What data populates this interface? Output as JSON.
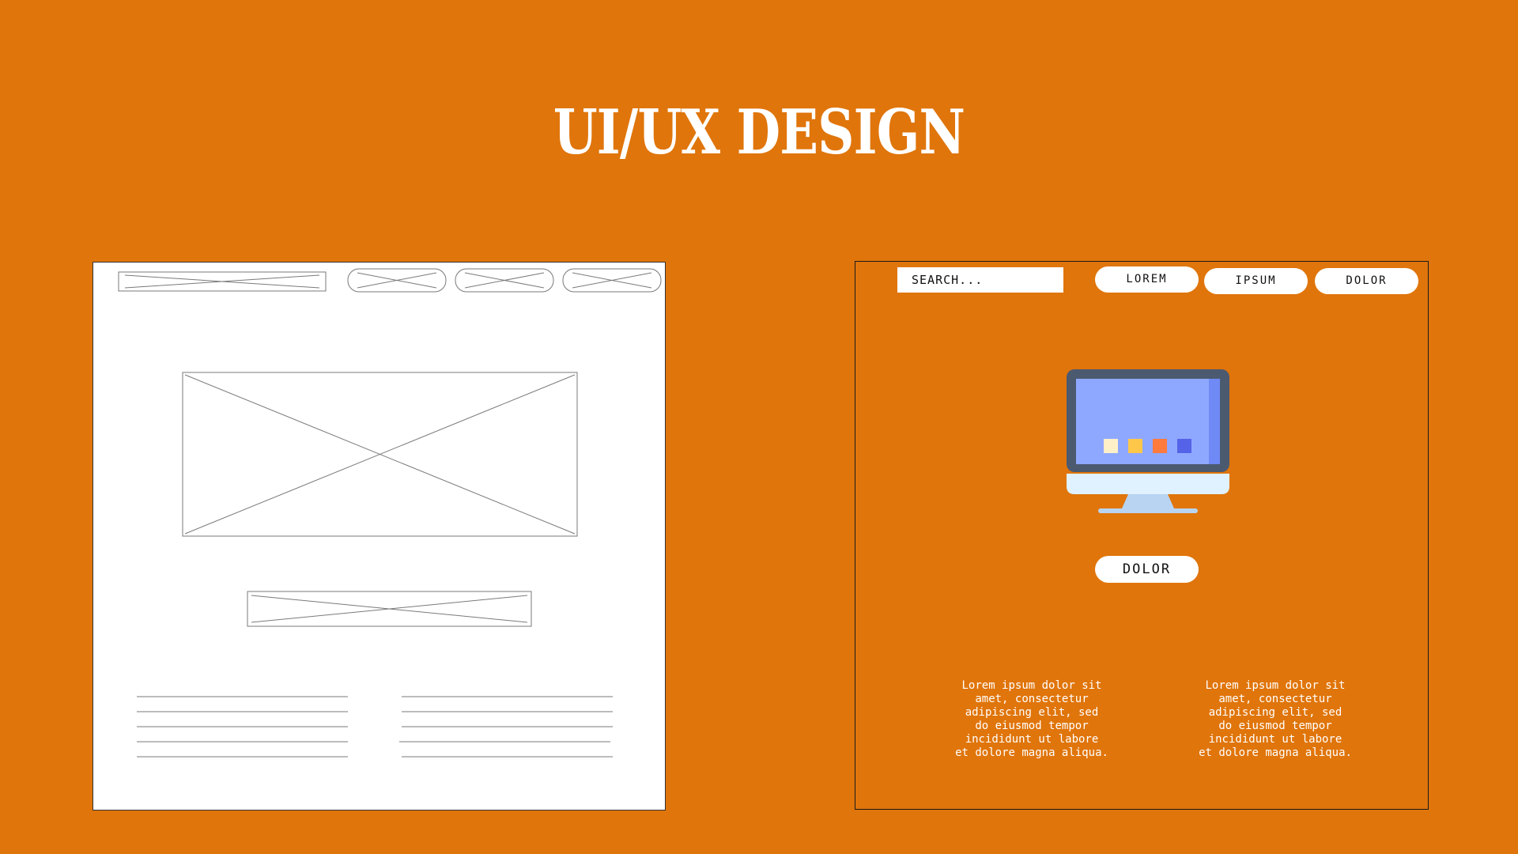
{
  "title": "UI/UX DESIGN",
  "colors": {
    "background": "#e0750b",
    "wireframe_bg": "#ffffff",
    "wireframe_line": "#7a7a7a",
    "button_bg": "#ffffff",
    "monitor_frame": "#4c5a70",
    "monitor_screen": "#8fa8ff",
    "monitor_stand": "#b8d4f2"
  },
  "wireframe": {
    "header_placeholder_icon": "crossed-box-placeholder",
    "nav_pills": 3,
    "text_line_columns": 2,
    "text_lines_per_column": 5
  },
  "mockup": {
    "search": {
      "placeholder": "SEARCH..."
    },
    "nav": [
      {
        "label": "LOREM"
      },
      {
        "label": "IPSUM"
      },
      {
        "label": "DOLOR"
      }
    ],
    "hero_icon": "desktop-monitor-icon",
    "cta_label": "DOLOR",
    "paragraphs": [
      "Lorem ipsum dolor sit\namet, consectetur\nadipiscing elit, sed\ndo eiusmod tempor\nincididunt ut labore\net dolore magna aliqua.",
      "Lorem ipsum dolor sit\namet, consectetur\nadipiscing elit, sed\ndo eiusmod tempor\nincididunt ut labore\net dolore magna aliqua."
    ]
  }
}
